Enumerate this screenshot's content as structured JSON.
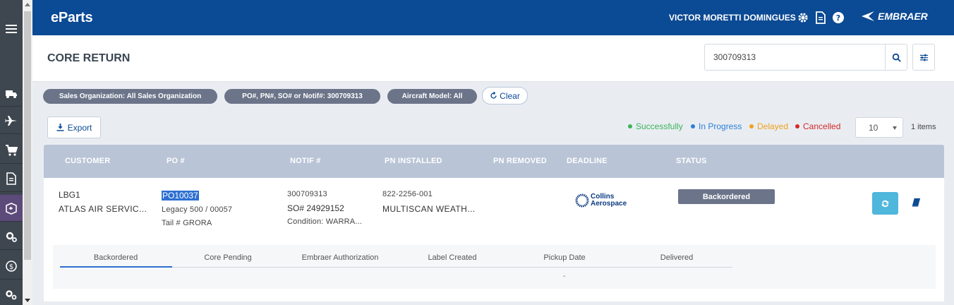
{
  "app": {
    "brand": "eParts",
    "user": "VICTOR MORETTI DOMINGUES",
    "logo_text": "EMBRAER"
  },
  "page": {
    "title": "CORE RETURN"
  },
  "search": {
    "value": "300709313"
  },
  "filters": {
    "chips": [
      "Sales Organization: All Sales Organization",
      "PO#, PN#, SO# or Notif#: 300709313",
      "Aircraft Model: All"
    ],
    "clear_label": "Clear"
  },
  "toolbar": {
    "export_label": "Export",
    "page_size": "10",
    "item_count": "1 items"
  },
  "legend": [
    {
      "label": "Successfully",
      "color": "#3cb45a"
    },
    {
      "label": "In Progress",
      "color": "#2d7fd6"
    },
    {
      "label": "Delayed",
      "color": "#f0a11f"
    },
    {
      "label": "Cancelled",
      "color": "#d42a2a"
    }
  ],
  "table": {
    "headers": [
      "CUSTOMER",
      "PO #",
      "NOTIF #",
      "PN INSTALLED",
      "PN REMOVED",
      "DEADLINE",
      "STATUS"
    ],
    "row": {
      "customer_code": "LBG1",
      "customer_name": "ATLAS AIR SERVIC...",
      "po": "PO10037",
      "po_model": "Legacy 500 / 00057",
      "po_tail": "Tail # GRORA",
      "notif": "300709313",
      "so": "SO# 24929152",
      "condition": "Condition: WARRA...",
      "pn_installed": "822-2256-001",
      "pn_desc": "MULTISCAN WEATH...",
      "supplier_logo_line1": "Collins",
      "supplier_logo_line2": "Aerospace",
      "status": "Backordered"
    }
  },
  "tracker": {
    "steps": [
      "Backordered",
      "Core Pending",
      "Embraer Authorization",
      "Label Created",
      "Pickup Date",
      "Delivered"
    ],
    "pickup_value": "-"
  }
}
